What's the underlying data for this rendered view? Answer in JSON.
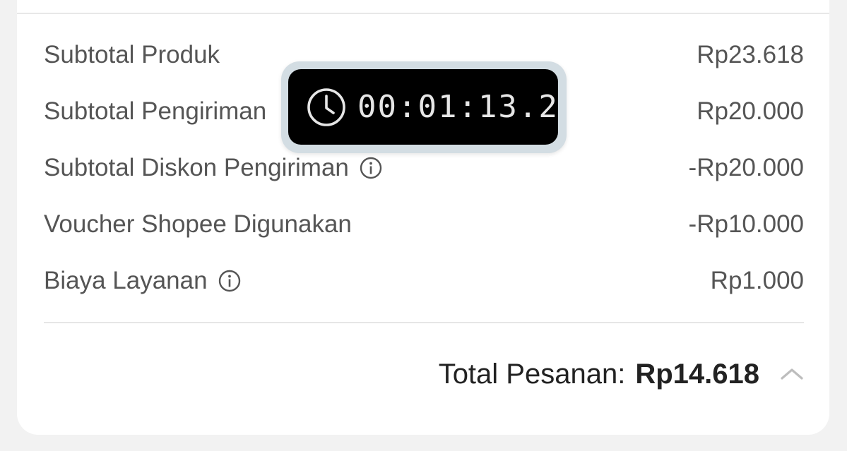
{
  "summary": {
    "rows": [
      {
        "label": "Subtotal Produk",
        "value": "Rp23.618",
        "has_info": false
      },
      {
        "label": "Subtotal Pengiriman",
        "value": "Rp20.000",
        "has_info": false
      },
      {
        "label": "Subtotal Diskon Pengiriman",
        "value": "-Rp20.000",
        "has_info": true
      },
      {
        "label": "Voucher Shopee Digunakan",
        "value": "-Rp10.000",
        "has_info": false
      },
      {
        "label": "Biaya Layanan",
        "value": "Rp1.000",
        "has_info": true
      }
    ],
    "total_label": "Total Pesanan:",
    "total_value": "Rp14.618"
  },
  "timer": {
    "text": "00:01:13.2"
  },
  "icons": {
    "info": "info-icon",
    "chevron": "chevron-up-icon",
    "clock": "clock-icon"
  },
  "colors": {
    "background": "#f2f2f2",
    "card": "#ffffff",
    "text_secondary": "#555555",
    "text_primary": "#222222",
    "timer_bg": "#000000",
    "timer_frame": "#d3dde3"
  }
}
